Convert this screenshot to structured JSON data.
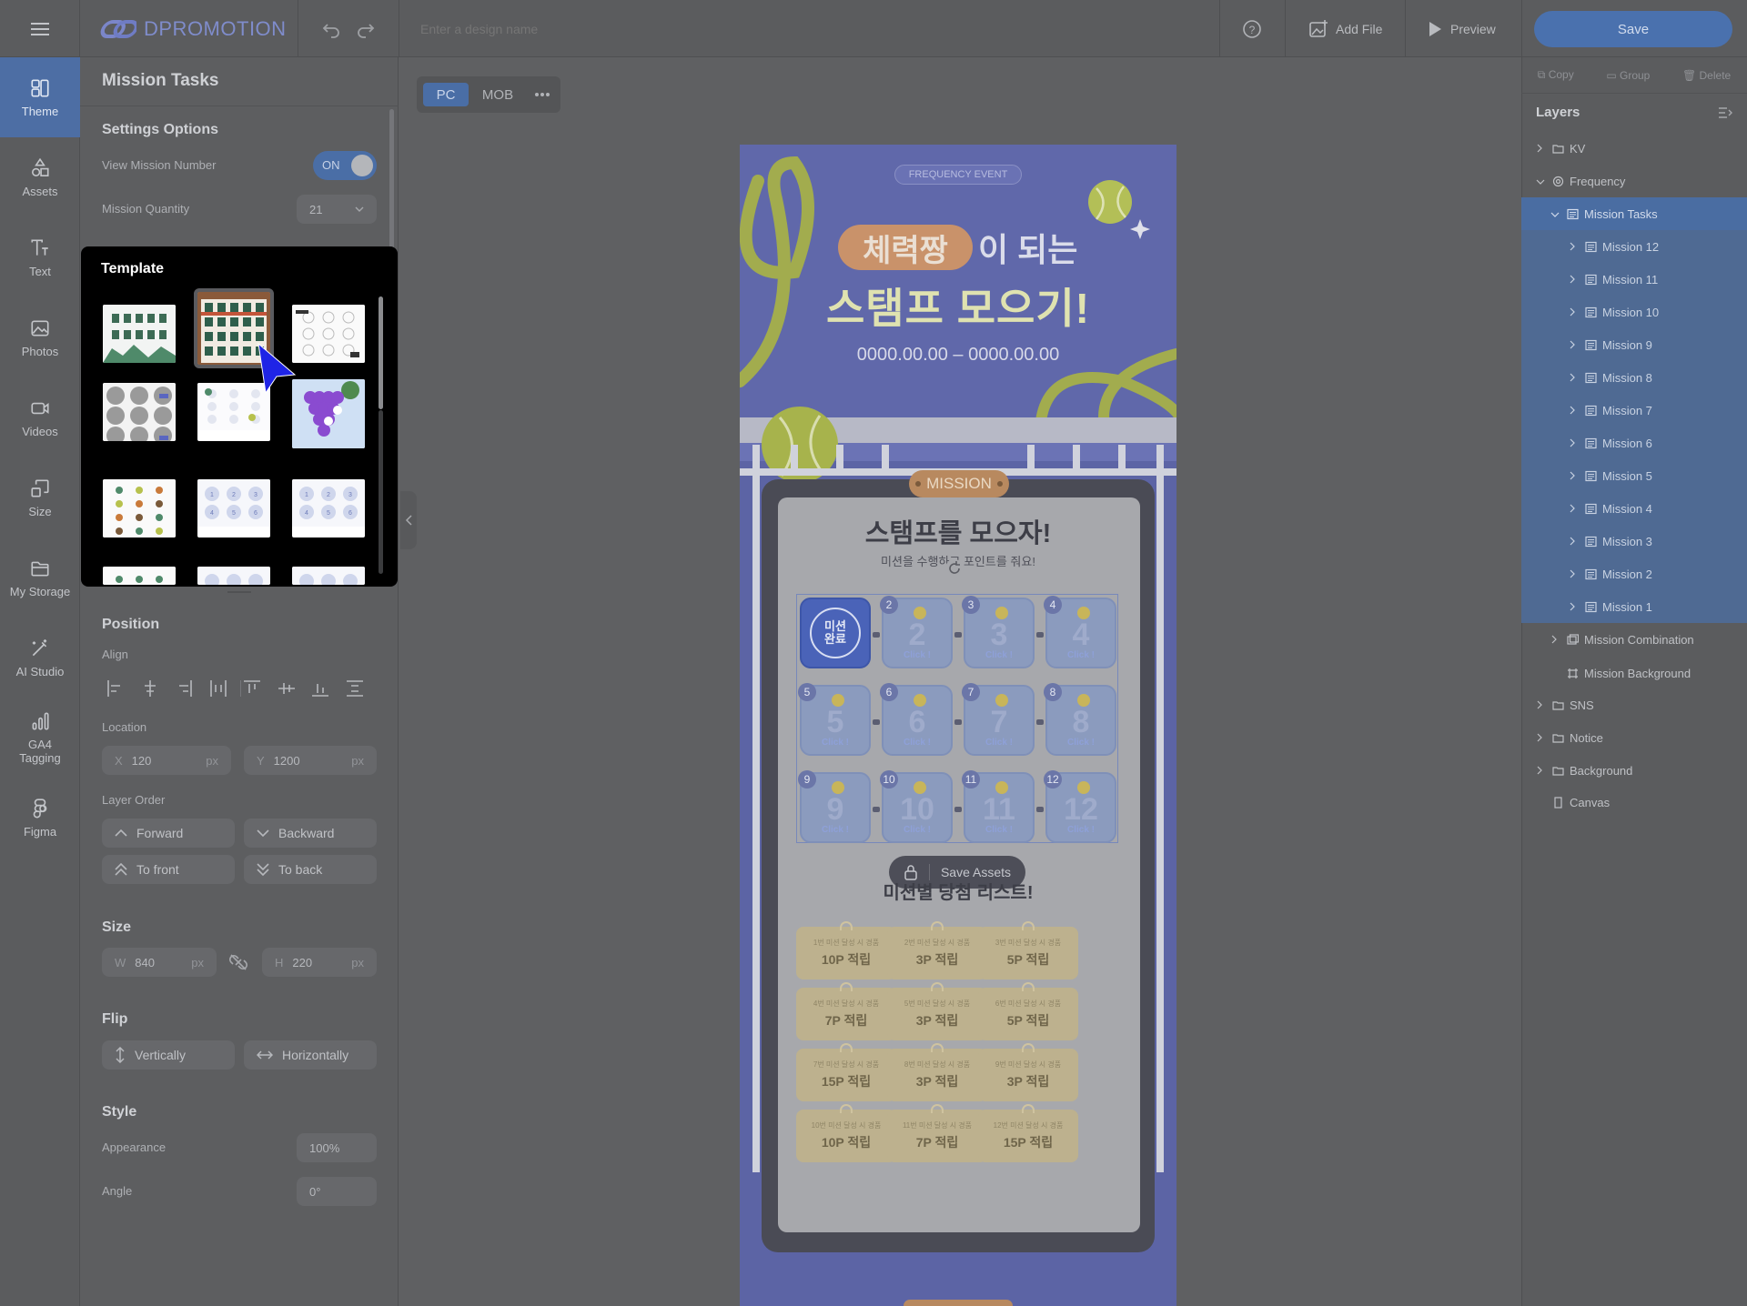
{
  "app": {
    "logo": "DPROMOTION",
    "design_name_placeholder": "Enter a design name",
    "add_file": "Add File",
    "preview": "Preview",
    "save": "Save"
  },
  "rail": {
    "items": [
      {
        "label": "Theme",
        "icon": "theme-icon"
      },
      {
        "label": "Assets",
        "icon": "shapes-icon"
      },
      {
        "label": "Text",
        "icon": "text-icon"
      },
      {
        "label": "Photos",
        "icon": "image-icon"
      },
      {
        "label": "Videos",
        "icon": "video-icon"
      },
      {
        "label": "Size",
        "icon": "resize-icon"
      },
      {
        "label": "My Storage",
        "icon": "folder-icon"
      },
      {
        "label": "AI Studio",
        "icon": "magic-wand-icon"
      },
      {
        "label": "GA4 Tagging",
        "icon": "bar-chart-icon"
      },
      {
        "label": "Figma",
        "icon": "figma-icon"
      }
    ]
  },
  "panel": {
    "title": "Mission Tasks",
    "settings_title": "Settings Options",
    "view_mission_number": "View Mission Number",
    "toggle": "ON",
    "mission_quantity_label": "Mission Quantity",
    "mission_quantity_value": "21",
    "template_title": "Template",
    "position_title": "Position",
    "align_label": "Align",
    "location_label": "Location",
    "x_label": "X",
    "x_value": "120",
    "y_label": "Y",
    "y_value": "1200",
    "px": "px",
    "layer_order_label": "Layer Order",
    "forward": "Forward",
    "backward": "Backward",
    "to_front": "To front",
    "to_back": "To back",
    "size_title": "Size",
    "w_label": "W",
    "w_value": "840",
    "h_label": "H",
    "h_value": "220",
    "flip_title": "Flip",
    "vertically": "Vertically",
    "horizontally": "Horizontally",
    "style_title": "Style",
    "appearance_label": "Appearance",
    "appearance_value": "100%",
    "angle_label": "Angle",
    "angle_value": "0°"
  },
  "canvas": {
    "tab_pc": "PC",
    "tab_mob": "MOB",
    "badge": "FREQUENCY EVENT",
    "headline_tag": "체력짱",
    "headline_rest": "이 되는",
    "headline2": "스탬프 모으기!",
    "date": "0000.00.00 – 0000.00.00",
    "mission_label": "MISSION",
    "stamp_title": "스탬프를 모으자!",
    "stamp_sub": "미션을 수행하고 포인트를 줘요!",
    "complete_stamp": "미션 완료",
    "click_label": "Click !",
    "save_assets": "Save Assets",
    "reward_title": "미션별 당첨 리스트!",
    "missions": [
      "2",
      "3",
      "4",
      "5",
      "6",
      "7",
      "8",
      "9",
      "10",
      "11",
      "12"
    ],
    "rewards": [
      {
        "small": "1번 미션 달성 시 경품",
        "big": "10P 적립"
      },
      {
        "small": "2번 미션 달성 시 경품",
        "big": "3P 적립"
      },
      {
        "small": "3번 미션 달성 시 경품",
        "big": "5P 적립"
      },
      {
        "small": "4번 미션 달성 시 경품",
        "big": "7P 적립"
      },
      {
        "small": "5번 미션 달성 시 경품",
        "big": "3P 적립"
      },
      {
        "small": "6번 미션 달성 시 경품",
        "big": "5P 적립"
      },
      {
        "small": "7번 미션 달성 시 경품",
        "big": "15P 적립"
      },
      {
        "small": "8번 미션 달성 시 경품",
        "big": "3P 적립"
      },
      {
        "small": "9번 미션 달성 시 경품",
        "big": "3P 적립"
      },
      {
        "small": "10번 미션 달성 시 경품",
        "big": "10P 적립"
      },
      {
        "small": "11번 미션 달성 시 경품",
        "big": "7P 적립"
      },
      {
        "small": "12번 미션 달성 시 경품",
        "big": "15P 적립"
      }
    ]
  },
  "right": {
    "copy": "Copy",
    "group": "Group",
    "delete": "Delete",
    "layers_title": "Layers",
    "layers": [
      {
        "label": "KV",
        "icon": "folder-icon",
        "level": 0,
        "state": "",
        "chevron": "right"
      },
      {
        "label": "Frequency",
        "icon": "frequency-icon",
        "level": 0,
        "state": "",
        "chevron": "down"
      },
      {
        "label": "Mission Tasks",
        "icon": "list-icon",
        "level": 1,
        "state": "sel",
        "chevron": "down"
      },
      {
        "label": "Mission 12",
        "icon": "list-icon",
        "level": 2,
        "state": "sub",
        "chevron": "right"
      },
      {
        "label": "Mission 11",
        "icon": "list-icon",
        "level": 2,
        "state": "sub",
        "chevron": "right"
      },
      {
        "label": "Mission 10",
        "icon": "list-icon",
        "level": 2,
        "state": "sub",
        "chevron": "right"
      },
      {
        "label": "Mission 9",
        "icon": "list-icon",
        "level": 2,
        "state": "sub",
        "chevron": "right"
      },
      {
        "label": "Mission 8",
        "icon": "list-icon",
        "level": 2,
        "state": "sub",
        "chevron": "right"
      },
      {
        "label": "Mission 7",
        "icon": "list-icon",
        "level": 2,
        "state": "sub",
        "chevron": "right"
      },
      {
        "label": "Mission 6",
        "icon": "list-icon",
        "level": 2,
        "state": "sub",
        "chevron": "right"
      },
      {
        "label": "Mission 5",
        "icon": "list-icon",
        "level": 2,
        "state": "sub",
        "chevron": "right"
      },
      {
        "label": "Mission 4",
        "icon": "list-icon",
        "level": 2,
        "state": "sub",
        "chevron": "right"
      },
      {
        "label": "Mission 3",
        "icon": "list-icon",
        "level": 2,
        "state": "sub",
        "chevron": "right"
      },
      {
        "label": "Mission 2",
        "icon": "list-icon",
        "level": 2,
        "state": "sub",
        "chevron": "right"
      },
      {
        "label": "Mission 1",
        "icon": "list-icon",
        "level": 2,
        "state": "sub",
        "chevron": "right"
      },
      {
        "label": "Mission Combination",
        "icon": "combination-icon",
        "level": 1,
        "state": "",
        "chevron": "right"
      },
      {
        "label": "Mission Background",
        "icon": "frame-icon",
        "level": 1,
        "state": "",
        "chevron": ""
      },
      {
        "label": "SNS",
        "icon": "folder-icon",
        "level": 0,
        "state": "",
        "chevron": "right"
      },
      {
        "label": "Notice",
        "icon": "folder-icon",
        "level": 0,
        "state": "",
        "chevron": "right"
      },
      {
        "label": "Background",
        "icon": "folder-icon",
        "level": 0,
        "state": "",
        "chevron": "right"
      },
      {
        "label": "Canvas",
        "icon": "canvas-icon",
        "level": 0,
        "state": "",
        "chevron": ""
      }
    ]
  }
}
